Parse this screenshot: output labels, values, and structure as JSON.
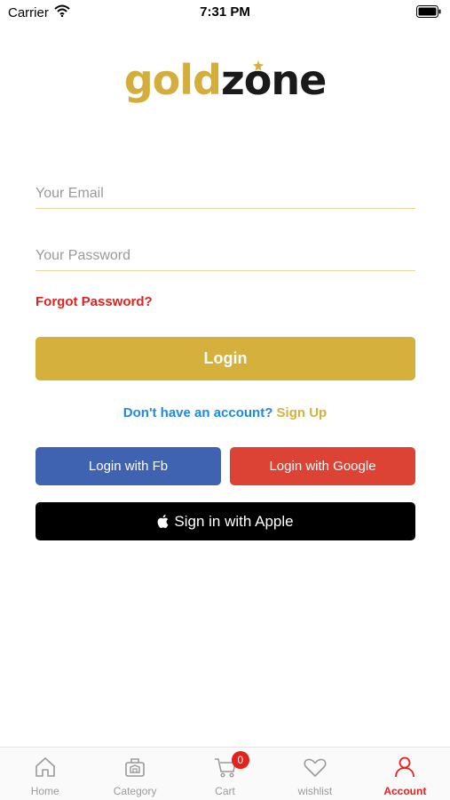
{
  "status_bar": {
    "carrier": "Carrier",
    "time": "7:31 PM"
  },
  "logo": {
    "gold": "gold",
    "zone": "zone"
  },
  "form": {
    "email_placeholder": "Your Email",
    "email_value": "",
    "password_placeholder": "Your Password",
    "password_value": "",
    "forgot_label": "Forgot Password?",
    "login_label": "Login"
  },
  "signup": {
    "prompt": "Don't have an account?",
    "link": "Sign Up"
  },
  "social": {
    "fb_label": "Login with Fb",
    "google_label": "Login with Google",
    "apple_label": "Sign in with Apple"
  },
  "tab_bar": {
    "items": [
      {
        "label": "Home",
        "icon": "home-icon"
      },
      {
        "label": "Category",
        "icon": "category-icon"
      },
      {
        "label": "Cart",
        "icon": "cart-icon",
        "badge": "0"
      },
      {
        "label": "wishlist",
        "icon": "heart-icon"
      },
      {
        "label": "Account",
        "icon": "account-icon",
        "active": true
      }
    ]
  },
  "colors": {
    "brand_gold": "#D5B03C",
    "accent_red": "#E4211C",
    "link_blue": "#1E88E5",
    "facebook_blue": "#3F63B0",
    "google_red": "#DD4335",
    "apple_black": "#000000"
  }
}
